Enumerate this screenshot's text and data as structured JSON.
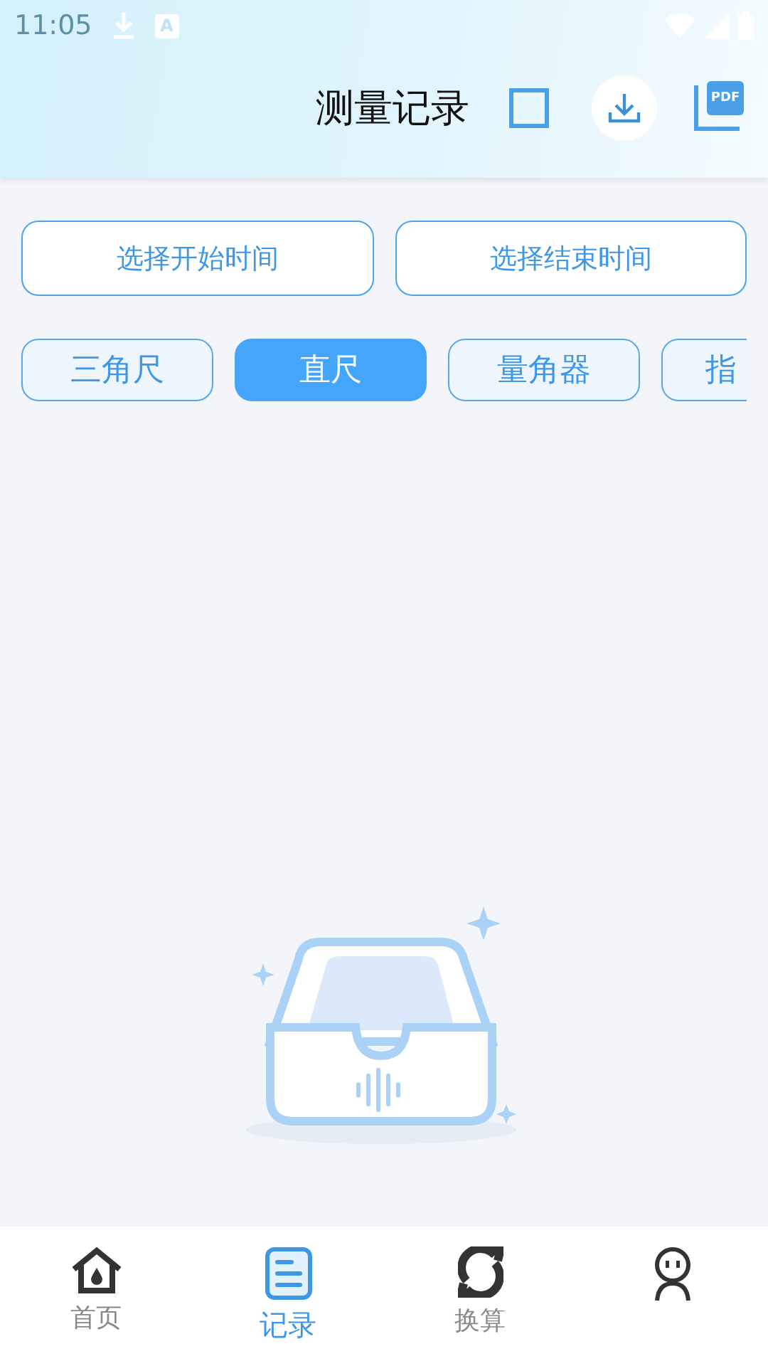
{
  "status_bar": {
    "time": "11:05",
    "app_badge": "A"
  },
  "header": {
    "title": "测量记录",
    "select_all_checked": false,
    "pdf_label": "PDF"
  },
  "date_buttons": [
    "选择开始时间",
    "选择结束时间"
  ],
  "tool_tabs": [
    {
      "label": "三角尺",
      "selected": false
    },
    {
      "label": "直尺",
      "selected": true
    },
    {
      "label": "量角器",
      "selected": false
    },
    {
      "label": "指",
      "selected": false
    }
  ],
  "bottom_nav": [
    {
      "kind": "home",
      "label": "首页",
      "selected": false
    },
    {
      "kind": "records",
      "label": "记录",
      "selected": true
    },
    {
      "kind": "convert",
      "label": "换算",
      "selected": false
    },
    {
      "kind": "profile",
      "selected": false
    }
  ]
}
